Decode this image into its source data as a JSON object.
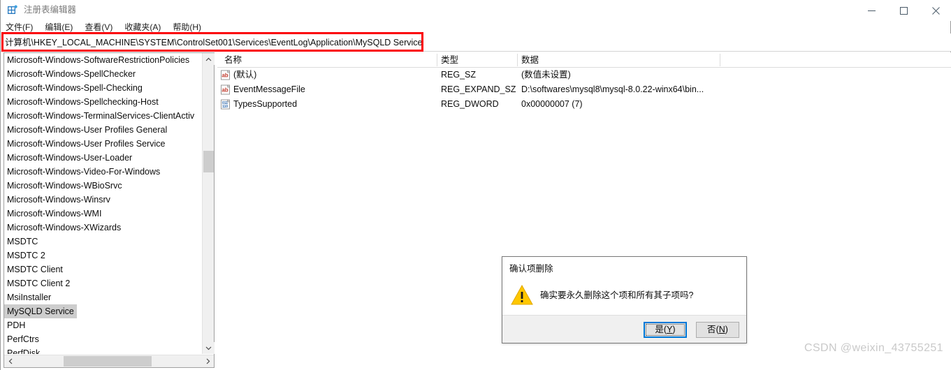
{
  "window": {
    "title": "注册表编辑器",
    "app_icon": "registry-editor-icon",
    "controls": {
      "minimize": "minimize-icon",
      "maximize": "maximize-icon",
      "close": "close-icon"
    }
  },
  "menubar": {
    "items": [
      {
        "label": "文件(F)"
      },
      {
        "label": "编辑(E)"
      },
      {
        "label": "查看(V)"
      },
      {
        "label": "收藏夹(A)"
      },
      {
        "label": "帮助(H)"
      }
    ]
  },
  "address": {
    "path": "计算机\\HKEY_LOCAL_MACHINE\\SYSTEM\\ControlSet001\\Services\\EventLog\\Application\\MySQLD Service",
    "highlight_color": "#fb0007"
  },
  "tree": {
    "items": [
      {
        "label": "Microsoft-Windows-SoftwareRestrictionPolicies",
        "selected": false
      },
      {
        "label": "Microsoft-Windows-SpellChecker",
        "selected": false
      },
      {
        "label": "Microsoft-Windows-Spell-Checking",
        "selected": false
      },
      {
        "label": "Microsoft-Windows-Spellchecking-Host",
        "selected": false
      },
      {
        "label": "Microsoft-Windows-TerminalServices-ClientActiv",
        "selected": false
      },
      {
        "label": "Microsoft-Windows-User Profiles General",
        "selected": false
      },
      {
        "label": "Microsoft-Windows-User Profiles Service",
        "selected": false
      },
      {
        "label": "Microsoft-Windows-User-Loader",
        "selected": false
      },
      {
        "label": "Microsoft-Windows-Video-For-Windows",
        "selected": false
      },
      {
        "label": "Microsoft-Windows-WBioSrvc",
        "selected": false
      },
      {
        "label": "Microsoft-Windows-Winsrv",
        "selected": false
      },
      {
        "label": "Microsoft-Windows-WMI",
        "selected": false
      },
      {
        "label": "Microsoft-Windows-XWizards",
        "selected": false
      },
      {
        "label": "MSDTC",
        "selected": false
      },
      {
        "label": "MSDTC 2",
        "selected": false
      },
      {
        "label": "MSDTC Client",
        "selected": false
      },
      {
        "label": "MSDTC Client 2",
        "selected": false
      },
      {
        "label": "MsiInstaller",
        "selected": false
      },
      {
        "label": "MySQLD Service",
        "selected": true
      },
      {
        "label": "PDH",
        "selected": false
      },
      {
        "label": "PerfCtrs",
        "selected": false
      },
      {
        "label": "PerfDisk",
        "selected": false
      }
    ],
    "selection_color": "#cdcdcd"
  },
  "values": {
    "columns": [
      "名称",
      "类型",
      "数据"
    ],
    "rows": [
      {
        "icon": "string-value-icon",
        "name": "(默认)",
        "type": "REG_SZ",
        "data": "(数值未设置)"
      },
      {
        "icon": "string-value-icon",
        "name": "EventMessageFile",
        "type": "REG_EXPAND_SZ",
        "data": "D:\\softwares\\mysql8\\mysql-8.0.22-winx64\\bin..."
      },
      {
        "icon": "dword-value-icon",
        "name": "TypesSupported",
        "type": "REG_DWORD",
        "data": "0x00000007 (7)"
      }
    ]
  },
  "dialog": {
    "title": "确认项删除",
    "icon": "warning-icon",
    "message": "确实要永久删除这个项和所有其子项吗?",
    "buttons": {
      "yes": {
        "text": "是",
        "accelerator": "Y",
        "focused": true
      },
      "no": {
        "text": "否",
        "accelerator": "N",
        "focused": false
      }
    },
    "focus_color": "#0078d7"
  },
  "watermark": {
    "text": "CSDN @weixin_43755251"
  }
}
